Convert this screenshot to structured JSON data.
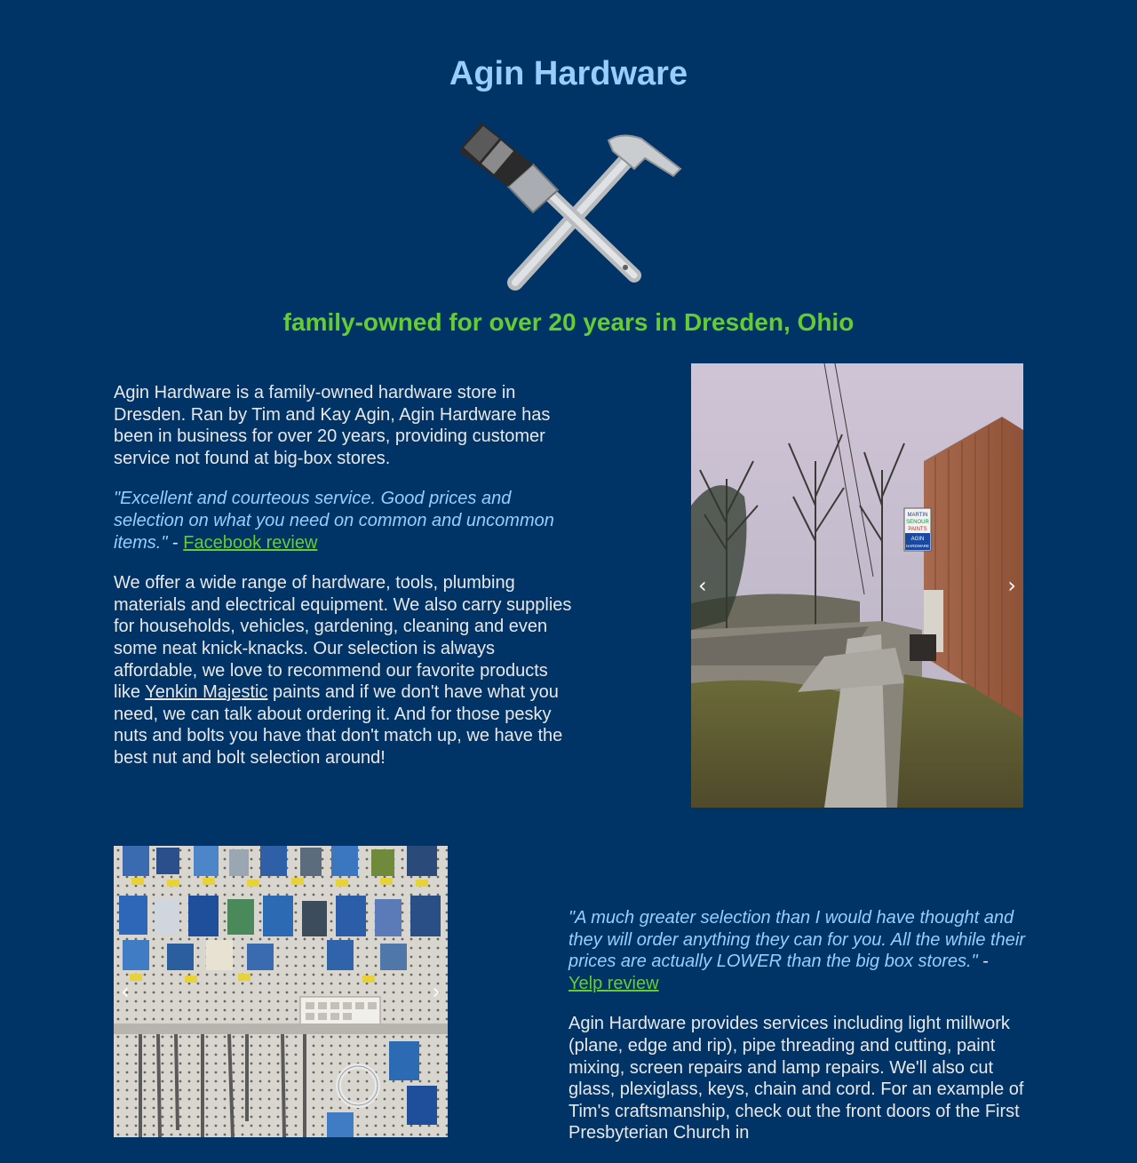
{
  "header": {
    "title": "Agin Hardware",
    "tagline": "family-owned for over 20 years in Dresden, Ohio"
  },
  "logo": {
    "icon": "paintbrush-hammer-icon"
  },
  "section1": {
    "intro": "Agin Hardware is a family-owned hardware store in Dresden. Ran by Tim and Kay Agin, Agin Hardware has been in business for over 20 years, providing customer service not found at big-box stores.",
    "review_quote": "\"Excellent and courteous service. Good prices and selection on what you need on common and uncommon items.\"",
    "review_dash": " - ",
    "review_link": "Facebook review",
    "offer_before": "We offer a wide range of hardware, tools, plumbing materials and electrical equipment. We also carry supplies for households, vehicles, gardening, cleaning and even some neat knick-knacks. Our selection is always affordable, we love to recommend our favorite products like ",
    "offer_link": "Yenkin Majestic",
    "offer_after": " paints and if we don't have what you need, we can talk about ordering it. And for those pesky nuts and bolts you have that don't match up, we have the best nut and bolt selection around!"
  },
  "carousel1": {
    "prev": "‹",
    "next": "›",
    "sign_lines": [
      "MARTIN",
      "SENOUR",
      "PAINTS",
      "AGIN",
      "HARDWARE"
    ]
  },
  "carousel2": {
    "prev": "‹",
    "next": "›"
  },
  "section2": {
    "review_quote": "\"A much greater selection than I would have thought and they will order anything they can for you. All the while their prices are actually LOWER than the big box stores.\"",
    "review_dash": " - ",
    "review_link": "Yelp review",
    "services": "Agin Hardware provides services including light millwork (plane, edge and rip), pipe threading and cutting, paint mixing, screen repairs and lamp repairs. We'll also cut glass, plexiglass, keys, chain and cord. For an example of Tim's craftsmanship, check out the front doors of the First Presbyterian Church in"
  },
  "colors": {
    "background": "#003366",
    "title": "#99ccff",
    "tagline": "#66cc33",
    "link": "#66cc33"
  }
}
